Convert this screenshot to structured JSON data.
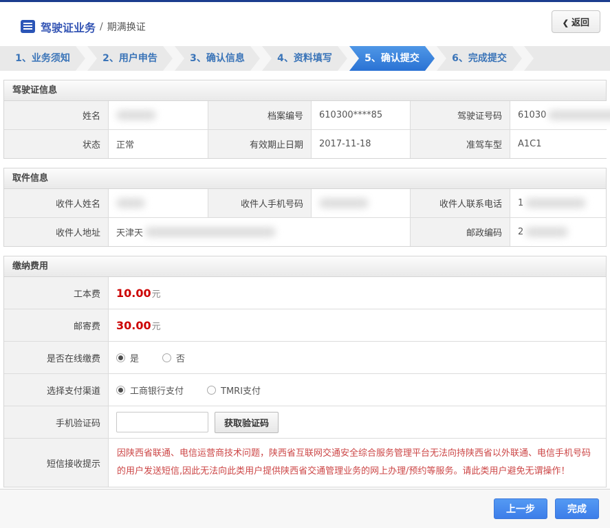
{
  "header": {
    "section_title": "驾驶证业务",
    "separator": "/",
    "page_title": "期满换证",
    "back_chevron": "❮",
    "back_label": "返回"
  },
  "steps": [
    {
      "label": "1、业务须知",
      "active": false
    },
    {
      "label": "2、用户申告",
      "active": false
    },
    {
      "label": "3、确认信息",
      "active": false
    },
    {
      "label": "4、资料填写",
      "active": false
    },
    {
      "label": "5、确认提交",
      "active": true
    },
    {
      "label": "6、完成提交",
      "active": false
    }
  ],
  "license_info": {
    "title": "驾驶证信息",
    "name": {
      "label": "姓名",
      "value": ""
    },
    "file_number": {
      "label": "档案编号",
      "value": "610300****85"
    },
    "license_number": {
      "label": "驾驶证号码",
      "value": "61030"
    },
    "status": {
      "label": "状态",
      "value": "正常"
    },
    "expiry_date": {
      "label": "有效期止日期",
      "value": "2017-11-18"
    },
    "vehicle_class": {
      "label": "准驾车型",
      "value": "A1C1"
    }
  },
  "pickup_info": {
    "title": "取件信息",
    "recipient_name": {
      "label": "收件人姓名",
      "value": ""
    },
    "recipient_mobile": {
      "label": "收件人手机号码",
      "value": ""
    },
    "recipient_phone": {
      "label": "收件人联系电话",
      "value": "1"
    },
    "recipient_address": {
      "label": "收件人地址",
      "value": "天津天"
    },
    "postal_code": {
      "label": "邮政编码",
      "value": "2"
    }
  },
  "fees": {
    "title": "缴纳费用",
    "production_fee": {
      "label": "工本费",
      "amount": "10.00",
      "unit": "元"
    },
    "postage_fee": {
      "label": "邮寄费",
      "amount": "30.00",
      "unit": "元"
    },
    "online_payment": {
      "label": "是否在线缴费",
      "options": [
        {
          "label": "是",
          "selected": true
        },
        {
          "label": "否",
          "selected": false
        }
      ]
    },
    "payment_channel": {
      "label": "选择支付渠道",
      "options": [
        {
          "label": "工商银行支付",
          "selected": true
        },
        {
          "label": "TMRI支付",
          "selected": false
        }
      ]
    },
    "sms_code": {
      "label": "手机验证码",
      "input_value": "",
      "button_label": "获取验证码"
    },
    "sms_notice": {
      "label": "短信接收提示",
      "message": "因陕西省联通、电信运营商技术问题，陕西省互联网交通安全综合服务管理平台无法向持陕西省以外联通、电信手机号码的用户发送短信,因此无法向此类用户提供陕西省交通管理业务的网上办理/预约等服务。请此类用户避免无谓操作！"
    }
  },
  "footer": {
    "prev_label": "上一步",
    "finish_label": "完成"
  },
  "colors": {
    "top_line": "#1c3d8e",
    "active_step_blue": "#2f7cdb",
    "button_blue": "#4589f0",
    "fee_red": "#cc0000",
    "notice_red": "#cc4646"
  }
}
